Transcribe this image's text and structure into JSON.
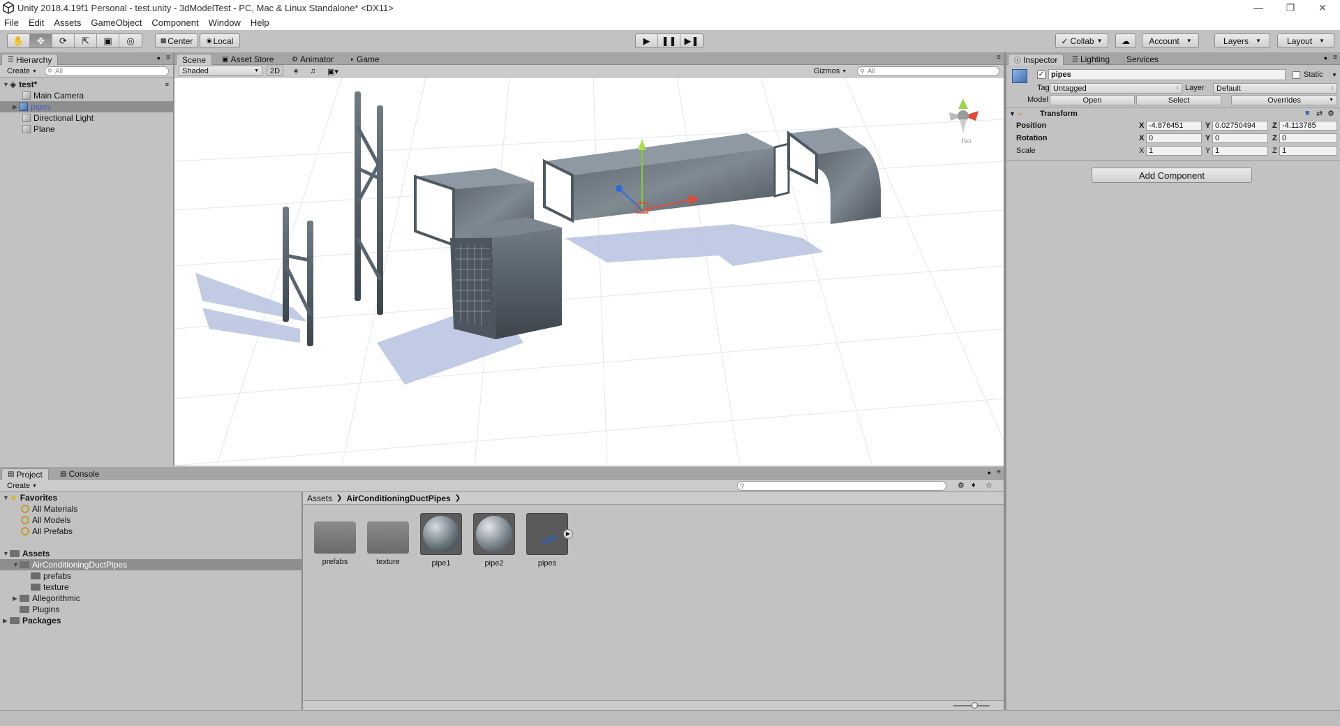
{
  "window": {
    "title": "Unity 2018.4.19f1 Personal - test.unity - 3dModelTest - PC, Mac & Linux Standalone* <DX11>"
  },
  "menu": [
    "File",
    "Edit",
    "Assets",
    "GameObject",
    "Component",
    "Window",
    "Help"
  ],
  "toolbar": {
    "pivot": "Center",
    "space": "Local",
    "collab": "Collab",
    "account": "Account",
    "layers": "Layers",
    "layout": "Layout"
  },
  "hierarchy": {
    "tab": "Hierarchy",
    "create": "Create",
    "search_placeholder": "All",
    "scene": "test*",
    "items": [
      "Main Camera",
      "pipes",
      "Directional Light",
      "Plane"
    ]
  },
  "scene_tabs": [
    "Scene",
    "Asset Store",
    "Animator",
    "Game"
  ],
  "scene_toolbar": {
    "shading": "Shaded",
    "mode2d": "2D",
    "gizmos": "Gizmos",
    "search_placeholder": "All",
    "iso_label": "Iso"
  },
  "inspector": {
    "tabs": [
      "Inspector",
      "Lighting",
      "Services"
    ],
    "object_name": "pipes",
    "static_label": "Static",
    "tag_label": "Tag",
    "tag_value": "Untagged",
    "layer_label": "Layer",
    "layer_value": "Default",
    "model_label": "Model",
    "model_open": "Open",
    "model_select": "Select",
    "model_overrides": "Overrides",
    "transform_title": "Transform",
    "position_label": "Position",
    "rotation_label": "Rotation",
    "scale_label": "Scale",
    "position": {
      "x": "-4.876451",
      "y": "0.02750494",
      "z": "-4.113785"
    },
    "rotation": {
      "x": "0",
      "y": "0",
      "z": "0"
    },
    "scale": {
      "x": "1",
      "y": "1",
      "z": "1"
    },
    "axis_x": "X",
    "axis_y": "Y",
    "axis_z": "Z",
    "add_component": "Add Component"
  },
  "project": {
    "tabs": [
      "Project",
      "Console"
    ],
    "create": "Create",
    "favorites_label": "Favorites",
    "favorites": [
      "All Materials",
      "All Models",
      "All Prefabs"
    ],
    "assets_label": "Assets",
    "tree": {
      "selected": "AirConditioningDuctPipes",
      "sub": [
        "prefabs",
        "texture"
      ],
      "others": [
        "Allegorithmic",
        "Plugins"
      ]
    },
    "packages_label": "Packages",
    "breadcrumb": [
      "Assets",
      "AirConditioningDuctPipes"
    ],
    "assets": [
      "prefabs",
      "texture",
      "pipe1",
      "pipe2",
      "pipes"
    ]
  },
  "colors": {
    "panel_bg": "#c2c2c2",
    "selection": "#8e8e8e",
    "hierarchy_selected_text": "#3a61c2"
  }
}
